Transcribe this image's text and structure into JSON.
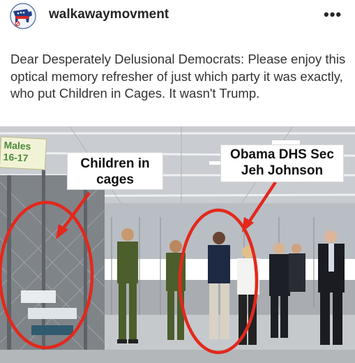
{
  "post": {
    "username": "walkawaymovment",
    "more_label": "•••",
    "caption_text": "Dear Desperately Delusional Democrats: Please enjoy this optical memory refresher of just which party it was exactly, who put Children in Cages. It wasn't Trump."
  },
  "photo": {
    "sign_line1": "Males",
    "sign_line2": "16-17",
    "label_left": "Children in cages",
    "label_right": "Obama DHS Sec Jeh Johnson"
  },
  "colors": {
    "annotation_red": "#e3281c",
    "uniform_green": "#4b5e2b",
    "text_dark": "#262626"
  }
}
